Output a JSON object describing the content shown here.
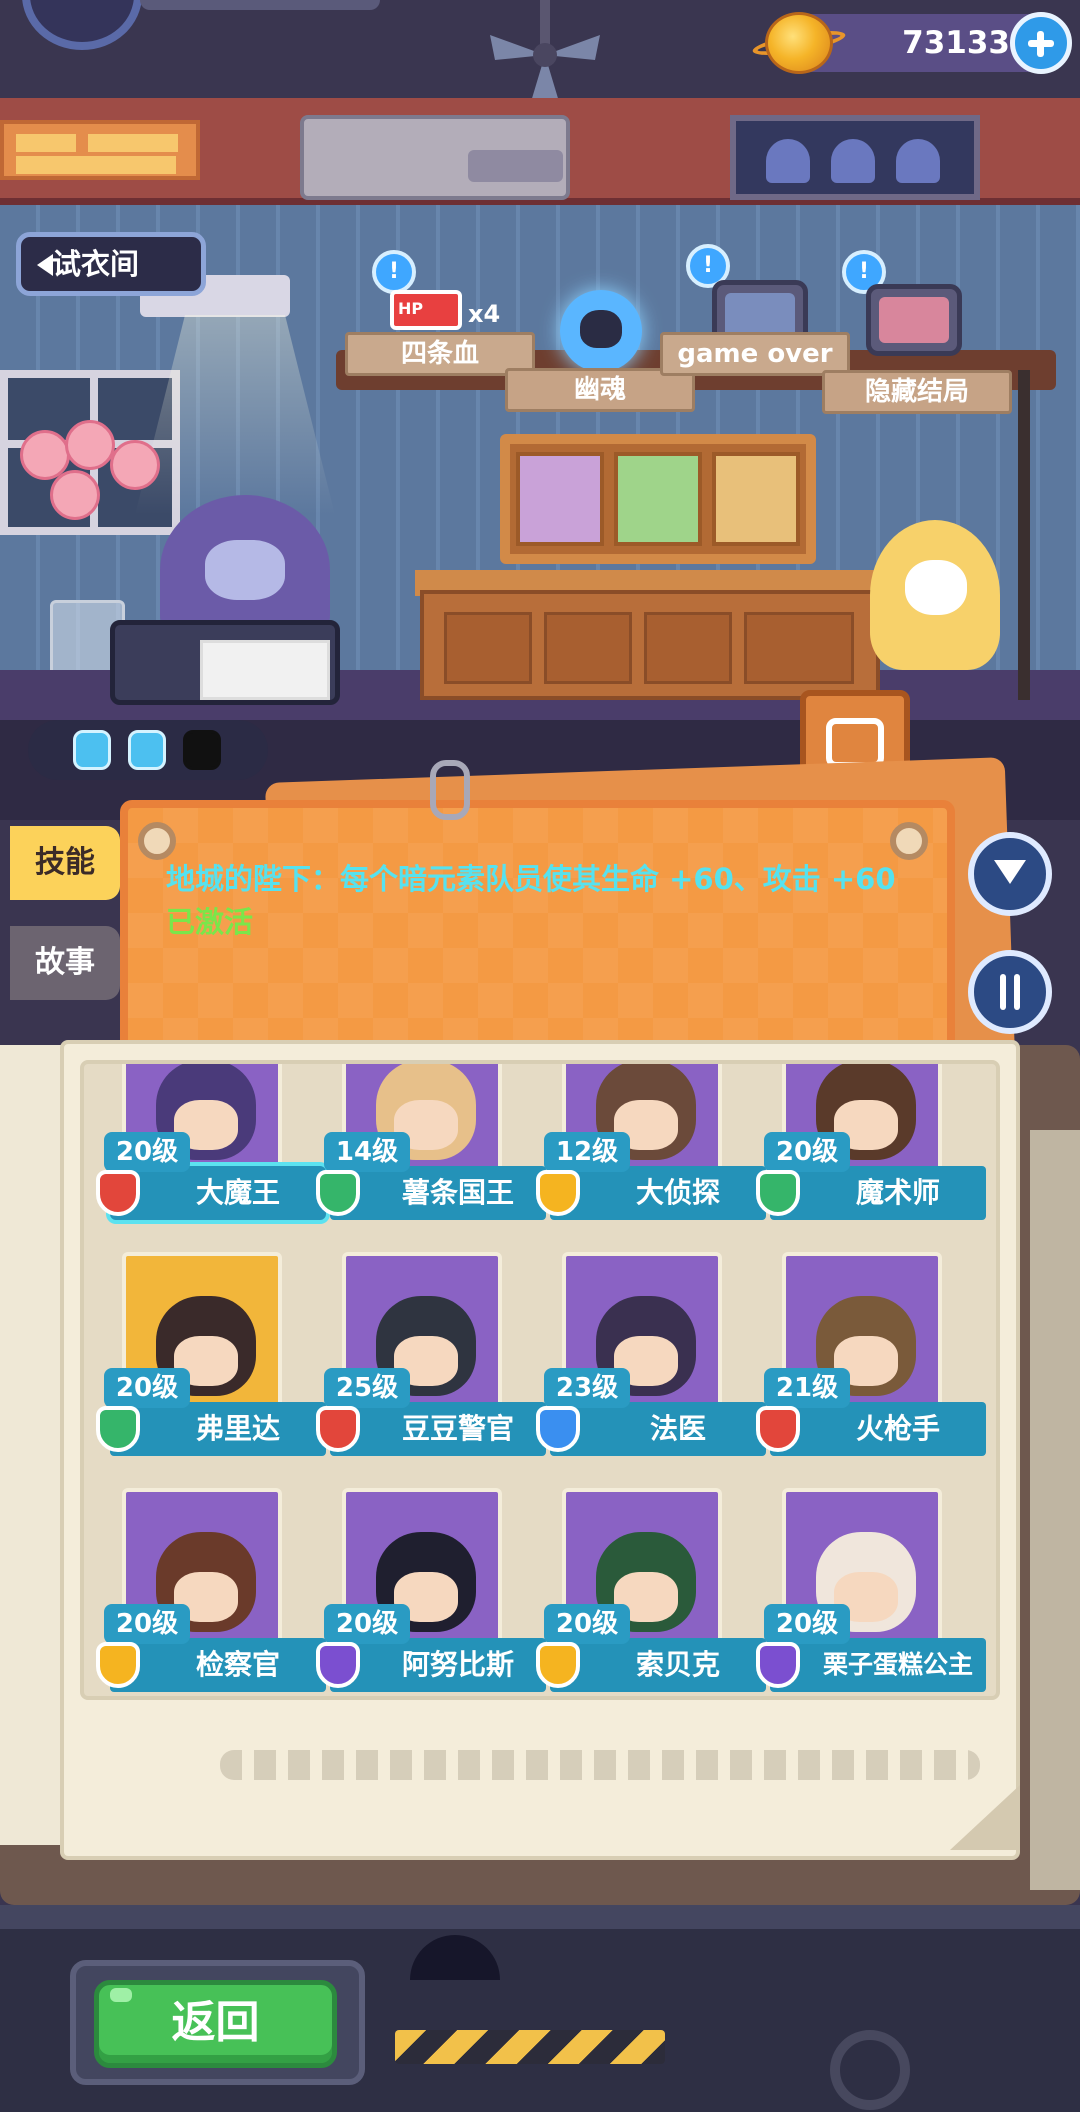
{
  "header": {
    "coins": "73133",
    "coin_icon": "planet-coin-icon",
    "add_coins_icon": "plus-icon"
  },
  "room": {
    "dressing_room_label": "试衣间",
    "achievements": [
      {
        "label": "四条血",
        "icon": "hp-battery-icon",
        "badge": "x4",
        "badge_icon_text": "HP"
      },
      {
        "label": "幽魂",
        "icon": "blue-skull-icon"
      },
      {
        "label": "game over",
        "icon": "tombstone-tv-icon"
      },
      {
        "label": "隐藏结局",
        "icon": "hidden-ending-tv-icon"
      }
    ],
    "energy": {
      "filled": 2,
      "total": 3,
      "icon": "lightning-icon"
    }
  },
  "tabs": {
    "skill": "技能",
    "story": "故事"
  },
  "skill": {
    "text": "地城的陛下：每个暗元素队员使其生命 +60、攻击 +60",
    "status": "已激活",
    "text_color": "#56e2ef",
    "status_color": "#7ae64a"
  },
  "controls": {
    "filter_icon": "filter-icon",
    "sort_icon": "sort-icon"
  },
  "characters": [
    {
      "level": "20级",
      "name": "大魔王",
      "element": "red",
      "art": "purple",
      "selected": true
    },
    {
      "level": "14级",
      "name": "薯条国王",
      "element": "green",
      "art": "purple"
    },
    {
      "level": "12级",
      "name": "大侦探",
      "element": "yellow",
      "art": "purple"
    },
    {
      "level": "20级",
      "name": "魔术师",
      "element": "green",
      "art": "purple"
    },
    {
      "level": "20级",
      "name": "弗里达",
      "element": "green",
      "art": "gold"
    },
    {
      "level": "25级",
      "name": "豆豆警官",
      "element": "red",
      "art": "purple"
    },
    {
      "level": "23级",
      "name": "法医",
      "element": "blue",
      "art": "purple"
    },
    {
      "level": "21级",
      "name": "火枪手",
      "element": "red",
      "art": "purple"
    },
    {
      "level": "20级",
      "name": "检察官",
      "element": "yellow",
      "art": "purple"
    },
    {
      "level": "20级",
      "name": "阿努比斯",
      "element": "purple",
      "art": "purple"
    },
    {
      "level": "20级",
      "name": "索贝克",
      "element": "yellow",
      "art": "purple"
    },
    {
      "level": "20级",
      "name": "栗子蛋糕公主",
      "element": "purple",
      "art": "purple"
    }
  ],
  "footer": {
    "back_label": "返回"
  },
  "colors": {
    "accent_blue": "#2492b8",
    "back_green": "#47c157",
    "panel_orange": "#f49a44"
  }
}
